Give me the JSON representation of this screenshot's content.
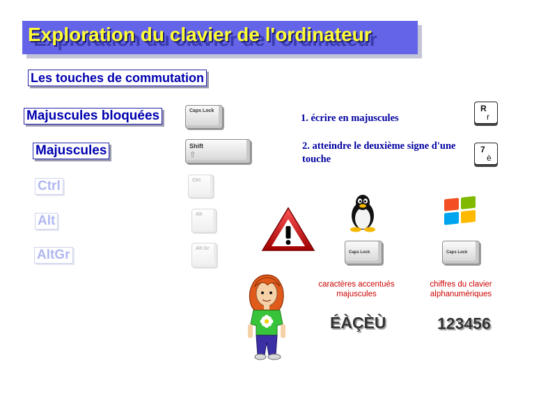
{
  "title": "Exploration du clavier de l'ordinateur",
  "section_heading": "Les touches de commutation",
  "keys": [
    {
      "label": "Majuscules bloquées",
      "cap": "Caps Lock",
      "active": true
    },
    {
      "label": "Majuscules",
      "cap": "Shift",
      "active": true
    },
    {
      "label": "Ctrl",
      "cap": "Ctrl",
      "active": false
    },
    {
      "label": "Alt",
      "cap": "Alt",
      "active": false
    },
    {
      "label": "AltGr",
      "cap": "Alt Gr",
      "active": false
    }
  ],
  "instructions": [
    {
      "text": "1. écrire en majuscules",
      "key_upper": "R",
      "key_lower": "r"
    },
    {
      "text": "2. atteindre le deuxième signe d'une touche",
      "key_upper": "7",
      "key_lower": "è"
    }
  ],
  "os_columns": [
    {
      "icon": "linux-penguin-icon",
      "cap": "Caps Lock",
      "caption": "caractères accentués majuscules",
      "sample": "ÉÀÇÈÙ"
    },
    {
      "icon": "windows-logo-icon",
      "cap": "Caps Lock",
      "caption": "chiffres du clavier alphanumériques",
      "sample": "123456"
    }
  ],
  "warning_icon": "exclamation-warning-icon",
  "mascot": "girl-character-illustration",
  "colors": {
    "banner": "#6464e8",
    "title": "#ffff33",
    "label": "#0000b0",
    "caption": "#cc0000"
  }
}
